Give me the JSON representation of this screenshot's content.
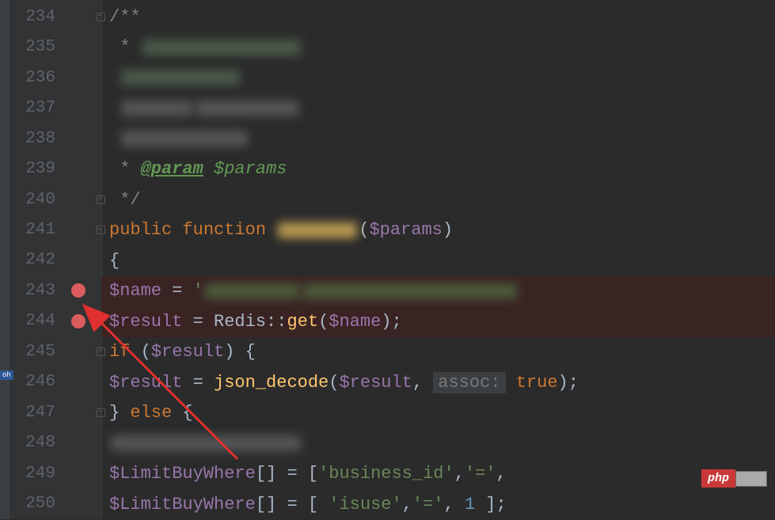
{
  "lines": {
    "l234": "234",
    "l235": "235",
    "l236": "236",
    "l237": "237",
    "l238": "238",
    "l239": "239",
    "l240": "240",
    "l241": "241",
    "l242": "242",
    "l243": "243",
    "l244": "244",
    "l245": "245",
    "l246": "246",
    "l247": "247",
    "l248": "248",
    "l249": "249",
    "l250": "250"
  },
  "code": {
    "c234_a": "/**",
    "c235_a": " * ",
    "c236_a": " ",
    "c237_a": " ",
    "c238_a": " ",
    "c239_a": " * ",
    "c239_b": "@param",
    "c239_c": " ",
    "c239_d": "$params",
    "c240_a": " */",
    "c241_a": "public",
    "c241_b": " ",
    "c241_c": "function",
    "c241_d": " ",
    "c241_e": "(",
    "c241_f": "$params",
    "c241_g": ")",
    "c242_a": "{",
    "c243_a": "$name",
    "c243_b": " = ",
    "c243_c": "'",
    "c244_a": "$result",
    "c244_b": " = ",
    "c244_c": "Redis",
    "c244_d": "::",
    "c244_e": "get",
    "c244_f": "(",
    "c244_g": "$name",
    "c244_h": ");",
    "c245_a": "if",
    "c245_b": " (",
    "c245_c": "$result",
    "c245_d": ") {",
    "c246_a": "$result",
    "c246_b": " = ",
    "c246_c": "json_decode",
    "c246_d": "(",
    "c246_e": "$result",
    "c246_f": ", ",
    "c246_assoc": "assoc:",
    "c246_g": " ",
    "c246_h": "true",
    "c246_i": ");",
    "c247_a": "} ",
    "c247_b": "else",
    "c247_c": " {",
    "c249_a": "$LimitBuyWhere",
    "c249_b": "[] = [",
    "c249_c": "'business_id'",
    "c249_d": ",",
    "c249_e": "'='",
    "c249_f": ",",
    "c250_a": "$LimitBuyWhere",
    "c250_b": "[] = [ ",
    "c250_c": "'isuse'",
    "c250_d": ",",
    "c250_e": "'='",
    "c250_f": ", ",
    "c250_g": "1",
    "c250_h": " ];"
  },
  "badges": {
    "php": "php",
    "oh": "oh"
  }
}
